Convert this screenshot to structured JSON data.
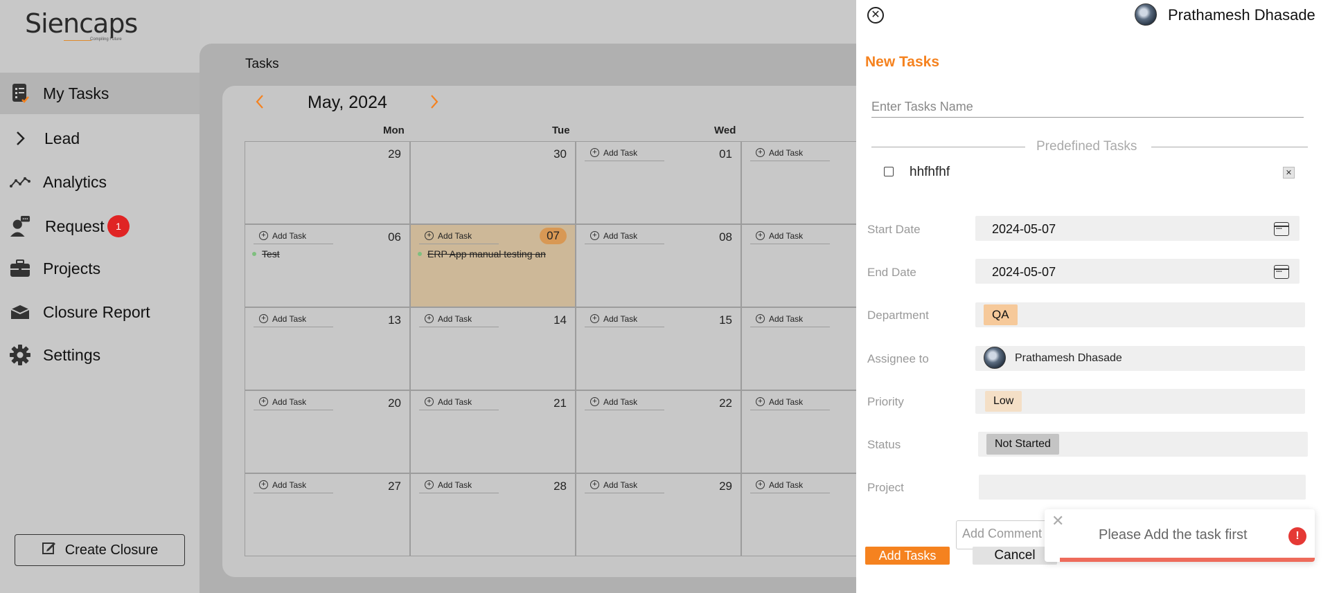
{
  "sidebar": {
    "logo": {
      "text": "Siencaps",
      "tagline": "Compiling Future"
    },
    "items": [
      {
        "label": "My Tasks",
        "icon": "tasks-icon",
        "active": true
      },
      {
        "label": "Lead",
        "icon": "chevron-right-icon"
      },
      {
        "label": "Analytics",
        "icon": "analytics-icon"
      },
      {
        "label": "Request",
        "icon": "request-icon",
        "badge": "1"
      },
      {
        "label": "Projects",
        "icon": "briefcase-icon"
      },
      {
        "label": "Closure Report",
        "icon": "report-icon"
      },
      {
        "label": "Settings",
        "icon": "gear-icon"
      }
    ],
    "create_closure": "Create Closure"
  },
  "main": {
    "title": "Tasks",
    "calendar": {
      "month_label": "May, 2024",
      "days_of_week": [
        "Mon",
        "Tue",
        "Wed"
      ],
      "add_task_label": "Add Task",
      "weeks": [
        [
          "29",
          "30",
          "01",
          ""
        ],
        [
          "06",
          "07",
          "08",
          ""
        ],
        [
          "13",
          "14",
          "15",
          ""
        ],
        [
          "20",
          "21",
          "22",
          ""
        ],
        [
          "27",
          "28",
          "29",
          ""
        ]
      ],
      "today": "07",
      "tasks": {
        "06": "Test",
        "07": "ERP App manual testing an"
      }
    }
  },
  "panel": {
    "user_name": "Prathamesh Dhasade",
    "title": "New Tasks",
    "task_name_placeholder": "Enter Tasks Name",
    "predefined_label": "Predefined Tasks",
    "predefined_items": [
      "hhfhfhf"
    ],
    "fields": {
      "start_date": {
        "label": "Start Date",
        "value": "2024-05-07"
      },
      "end_date": {
        "label": "End Date",
        "value": "2024-05-07"
      },
      "department": {
        "label": "Department",
        "value": "QA"
      },
      "assignee": {
        "label": "Assignee to",
        "value": "Prathamesh Dhasade"
      },
      "priority": {
        "label": "Priority",
        "value": "Low"
      },
      "status": {
        "label": "Status",
        "value": "Not Started"
      },
      "project": {
        "label": "Project",
        "value": ""
      }
    },
    "comment_placeholder": "Add Comment",
    "add_button": "Add Tasks",
    "cancel_button": "Cancel"
  },
  "toast": {
    "message": "Please Add the task first",
    "icon": "!"
  },
  "colors": {
    "accent": "#f5821f",
    "badge": "#e02424",
    "today_cell": "#cdb898",
    "toast_bar": "#ee6b5b"
  }
}
